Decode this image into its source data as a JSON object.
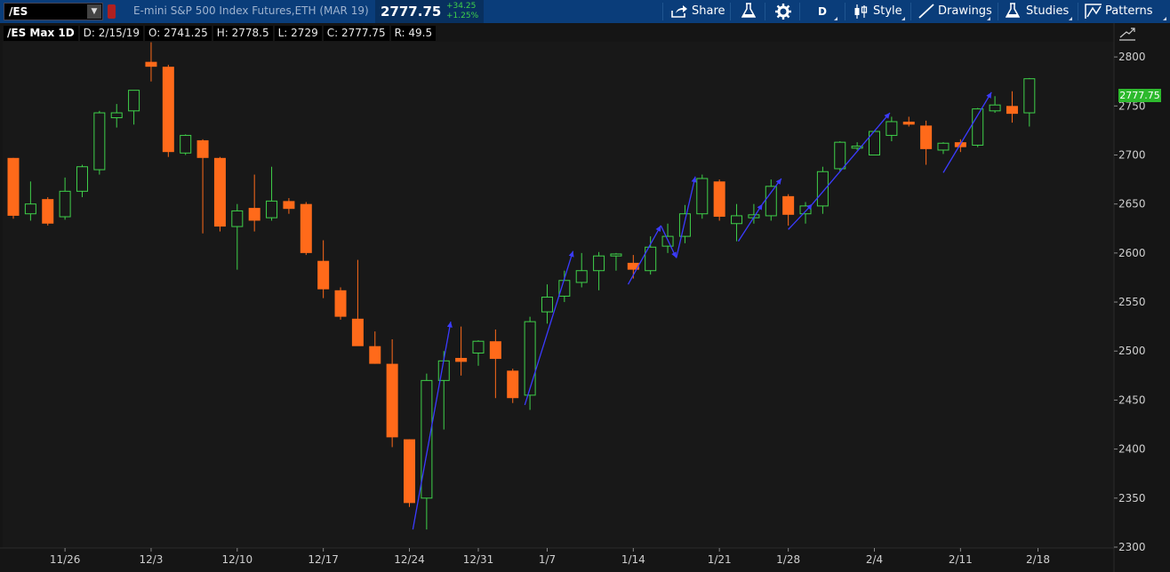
{
  "toolbar": {
    "symbol": "/ES",
    "instrument": "E-mini S&P 500 Index Futures,ETH (MAR 19)",
    "last_price": "2777.75",
    "net_change": "+34.25",
    "percent_change": "+1.25%",
    "share_label": "Share",
    "aggregation_label": "D",
    "style_label": "Style",
    "drawings_label": "Drawings",
    "studies_label": "Studies",
    "patterns_label": "Patterns"
  },
  "infobar": {
    "title": "/ES Max 1D",
    "date": "D: 2/15/19",
    "open": "O: 2741.25",
    "high": "H: 2778.5",
    "low": "L: 2729",
    "close": "C: 2777.75",
    "range": "R: 49.5"
  },
  "price_label": "2777.75",
  "colors": {
    "up": "#3fd14a",
    "down": "#ff6a1a",
    "trend": "#3b3bff",
    "toolbar": "#0a3d7a"
  },
  "icons": [
    "share-icon",
    "beaker-icon",
    "gear-icon",
    "style-icon",
    "drawings-icon",
    "studies-icon",
    "patterns-icon",
    "expand-icon"
  ],
  "chart_data": {
    "type": "candlestick",
    "ylim": [
      2300,
      2830
    ],
    "y_ticks": [
      "2800",
      "2750",
      "2700",
      "2650",
      "2600",
      "2550",
      "2500",
      "2450",
      "2400",
      "2350",
      "2300"
    ],
    "x_ticks": [
      {
        "label": "11/26",
        "bar": 3
      },
      {
        "label": "12/3",
        "bar": 8
      },
      {
        "label": "12/10",
        "bar": 13
      },
      {
        "label": "12/17",
        "bar": 18
      },
      {
        "label": "12/24",
        "bar": 23
      },
      {
        "label": "12/31",
        "bar": 27
      },
      {
        "label": "1/7",
        "bar": 31
      },
      {
        "label": "1/14",
        "bar": 36
      },
      {
        "label": "1/21",
        "bar": 41
      },
      {
        "label": "1/28",
        "bar": 45
      },
      {
        "label": "2/4",
        "bar": 50
      },
      {
        "label": "2/11",
        "bar": 55
      },
      {
        "label": "2/18",
        "bar": 59.5
      }
    ],
    "candles": [
      {
        "o": 2697,
        "h": 2697,
        "l": 2635,
        "c": 2638
      },
      {
        "o": 2640,
        "h": 2673,
        "l": 2633,
        "c": 2650
      },
      {
        "o": 2655,
        "h": 2657,
        "l": 2628,
        "c": 2630
      },
      {
        "o": 2637,
        "h": 2677,
        "l": 2634,
        "c": 2663
      },
      {
        "o": 2663,
        "h": 2690,
        "l": 2657,
        "c": 2688
      },
      {
        "o": 2685,
        "h": 2745,
        "l": 2680,
        "c": 2743
      },
      {
        "o": 2738,
        "h": 2752,
        "l": 2728,
        "c": 2743
      },
      {
        "o": 2745,
        "h": 2766,
        "l": 2731,
        "c": 2766
      },
      {
        "o": 2795,
        "h": 2815,
        "l": 2775,
        "c": 2790
      },
      {
        "o": 2790,
        "h": 2792,
        "l": 2698,
        "c": 2703
      },
      {
        "o": 2702,
        "h": 2721,
        "l": 2700,
        "c": 2720
      },
      {
        "o": 2715,
        "h": 2716,
        "l": 2620,
        "c": 2697
      },
      {
        "o": 2697,
        "h": 2698,
        "l": 2622,
        "c": 2627
      },
      {
        "o": 2627,
        "h": 2650,
        "l": 2583,
        "c": 2643
      },
      {
        "o": 2646,
        "h": 2680,
        "l": 2622,
        "c": 2633
      },
      {
        "o": 2636,
        "h": 2688,
        "l": 2633,
        "c": 2653
      },
      {
        "o": 2653,
        "h": 2656,
        "l": 2640,
        "c": 2645
      },
      {
        "o": 2650,
        "h": 2652,
        "l": 2598,
        "c": 2600
      },
      {
        "o": 2592,
        "h": 2613,
        "l": 2554,
        "c": 2563
      },
      {
        "o": 2562,
        "h": 2565,
        "l": 2532,
        "c": 2535
      },
      {
        "o": 2533,
        "h": 2593,
        "l": 2513,
        "c": 2505
      },
      {
        "o": 2505,
        "h": 2520,
        "l": 2487,
        "c": 2487
      },
      {
        "o": 2487,
        "h": 2512,
        "l": 2402,
        "c": 2412
      },
      {
        "o": 2410,
        "h": 2410,
        "l": 2341,
        "c": 2345
      },
      {
        "o": 2350,
        "h": 2477,
        "l": 2318,
        "c": 2470
      },
      {
        "o": 2470,
        "h": 2500,
        "l": 2420,
        "c": 2490
      },
      {
        "o": 2493,
        "h": 2525,
        "l": 2475,
        "c": 2489
      },
      {
        "o": 2498,
        "h": 2511,
        "l": 2485,
        "c": 2510
      },
      {
        "o": 2510,
        "h": 2522,
        "l": 2452,
        "c": 2492
      },
      {
        "o": 2480,
        "h": 2482,
        "l": 2447,
        "c": 2452
      },
      {
        "o": 2455,
        "h": 2535,
        "l": 2440,
        "c": 2530
      },
      {
        "o": 2540,
        "h": 2568,
        "l": 2528,
        "c": 2555
      },
      {
        "o": 2556,
        "h": 2582,
        "l": 2550,
        "c": 2572
      },
      {
        "o": 2570,
        "h": 2600,
        "l": 2565,
        "c": 2582
      },
      {
        "o": 2582,
        "h": 2601,
        "l": 2562,
        "c": 2597
      },
      {
        "o": 2597,
        "h": 2600,
        "l": 2582,
        "c": 2599
      },
      {
        "o": 2590,
        "h": 2598,
        "l": 2574,
        "c": 2583
      },
      {
        "o": 2582,
        "h": 2617,
        "l": 2578,
        "c": 2606
      },
      {
        "o": 2607,
        "h": 2630,
        "l": 2600,
        "c": 2617
      },
      {
        "o": 2617,
        "h": 2649,
        "l": 2610,
        "c": 2640
      },
      {
        "o": 2640,
        "h": 2680,
        "l": 2635,
        "c": 2676
      },
      {
        "o": 2673,
        "h": 2675,
        "l": 2633,
        "c": 2637
      },
      {
        "o": 2630,
        "h": 2650,
        "l": 2612,
        "c": 2638
      },
      {
        "o": 2636,
        "h": 2650,
        "l": 2630,
        "c": 2639
      },
      {
        "o": 2638,
        "h": 2675,
        "l": 2633,
        "c": 2668
      },
      {
        "o": 2658,
        "h": 2660,
        "l": 2628,
        "c": 2639
      },
      {
        "o": 2640,
        "h": 2652,
        "l": 2630,
        "c": 2648
      },
      {
        "o": 2648,
        "h": 2688,
        "l": 2640,
        "c": 2683
      },
      {
        "o": 2686,
        "h": 2714,
        "l": 2683,
        "c": 2713
      },
      {
        "o": 2707,
        "h": 2713,
        "l": 2705,
        "c": 2709
      },
      {
        "o": 2700,
        "h": 2725,
        "l": 2700,
        "c": 2724
      },
      {
        "o": 2720,
        "h": 2739,
        "l": 2714,
        "c": 2734
      },
      {
        "o": 2734,
        "h": 2739,
        "l": 2729,
        "c": 2731
      },
      {
        "o": 2730,
        "h": 2735,
        "l": 2690,
        "c": 2706
      },
      {
        "o": 2705,
        "h": 2713,
        "l": 2701,
        "c": 2712
      },
      {
        "o": 2713,
        "h": 2716,
        "l": 2703,
        "c": 2708
      },
      {
        "o": 2710,
        "h": 2748,
        "l": 2708,
        "c": 2747
      },
      {
        "o": 2745,
        "h": 2760,
        "l": 2743,
        "c": 2751
      },
      {
        "o": 2750,
        "h": 2765,
        "l": 2733,
        "c": 2742
      },
      {
        "o": 2743,
        "h": 2778.5,
        "l": 2729,
        "c": 2777.75
      }
    ],
    "trendlines": [
      {
        "x1": 23.2,
        "y1": 2318,
        "x2": 25.4,
        "y2": 2530
      },
      {
        "x1": 29.7,
        "y1": 2445,
        "x2": 32.5,
        "y2": 2602
      },
      {
        "x1": 35.7,
        "y1": 2568,
        "x2": 37.6,
        "y2": 2628
      },
      {
        "x1": 37.6,
        "y1": 2628,
        "x2": 38.5,
        "y2": 2595
      },
      {
        "x1": 38.5,
        "y1": 2595,
        "x2": 39.6,
        "y2": 2678
      },
      {
        "x1": 42.1,
        "y1": 2612,
        "x2": 43.5,
        "y2": 2650
      },
      {
        "x1": 43.5,
        "y1": 2650,
        "x2": 44.6,
        "y2": 2676
      },
      {
        "x1": 45.0,
        "y1": 2624,
        "x2": 46.4,
        "y2": 2650
      },
      {
        "x1": 46.4,
        "y1": 2650,
        "x2": 50.9,
        "y2": 2743
      },
      {
        "x1": 54.0,
        "y1": 2682,
        "x2": 56.8,
        "y2": 2764
      }
    ]
  }
}
